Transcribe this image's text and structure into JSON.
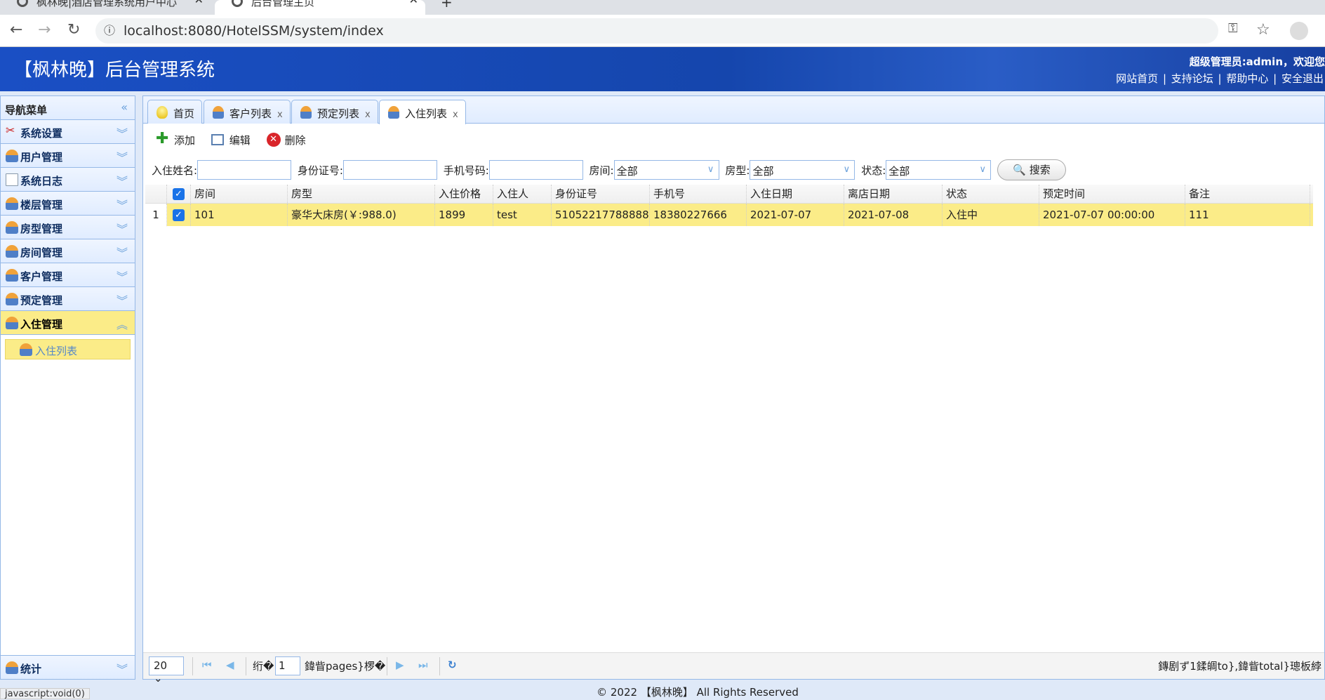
{
  "browser": {
    "tabs": [
      {
        "title": "枫林晚|酒店管理系统用户中心"
      },
      {
        "title": "后台管理主页"
      }
    ],
    "url": "localhost:8080/HotelSSM/system/index"
  },
  "header": {
    "title": "【枫林晚】后台管理系统",
    "welcome": "超级管理员:admin，欢迎您",
    "links": [
      "网站首页",
      "支持论坛",
      "帮助中心",
      "安全退出"
    ]
  },
  "sidebar": {
    "title": "导航菜单",
    "items": [
      {
        "label": "系统设置",
        "icon": "tools-icon"
      },
      {
        "label": "用户管理"
      },
      {
        "label": "系统日志",
        "icon": "log-icon"
      },
      {
        "label": "楼层管理"
      },
      {
        "label": "房型管理"
      },
      {
        "label": "房间管理"
      },
      {
        "label": "客户管理"
      },
      {
        "label": "预定管理"
      },
      {
        "label": "入住管理",
        "active": true
      }
    ],
    "sub_items": [
      {
        "label": "入住列表"
      }
    ],
    "bottom": {
      "label": "统计"
    }
  },
  "tabs": [
    {
      "label": "首页",
      "closable": false
    },
    {
      "label": "客户列表"
    },
    {
      "label": "预定列表"
    },
    {
      "label": "入住列表",
      "selected": true
    }
  ],
  "toolbar": {
    "add": "添加",
    "edit": "编辑",
    "delete": "删除"
  },
  "filter": {
    "name_label": "入住姓名:",
    "id_label": "身份证号:",
    "phone_label": "手机号码:",
    "room_label": "房间:",
    "room_value": "全部",
    "type_label": "房型:",
    "type_value": "全部",
    "status_label": "状态:",
    "status_value": "全部",
    "search": "搜索"
  },
  "grid": {
    "columns": [
      "房间",
      "房型",
      "入住价格",
      "入住人",
      "身份证号",
      "手机号",
      "入住日期",
      "离店日期",
      "状态",
      "预定时间",
      "备注"
    ],
    "rows": [
      {
        "num": "1",
        "checked": true,
        "cells": [
          "101",
          "豪华大床房(￥:988.0)",
          "1899",
          "test",
          "51052217788888",
          "18380227666",
          "2021-07-07",
          "2021-07-08",
          "入住中",
          "2021-07-07 00:00:00",
          "111"
        ]
      }
    ]
  },
  "pager": {
    "page_size": "20",
    "before": "绗�",
    "page": "1",
    "after": "鍏眥pages}椤�",
    "info": "鏄剧ず1鍒皗to},鍏眥total}璁板綍"
  },
  "footer": "© 2022 【枫林晚】 All Rights Reserved",
  "status_bar": "javascript:void(0)",
  "colors": {
    "header": "#1546ad",
    "active": "#fbec88",
    "border": "#95b8e7"
  }
}
